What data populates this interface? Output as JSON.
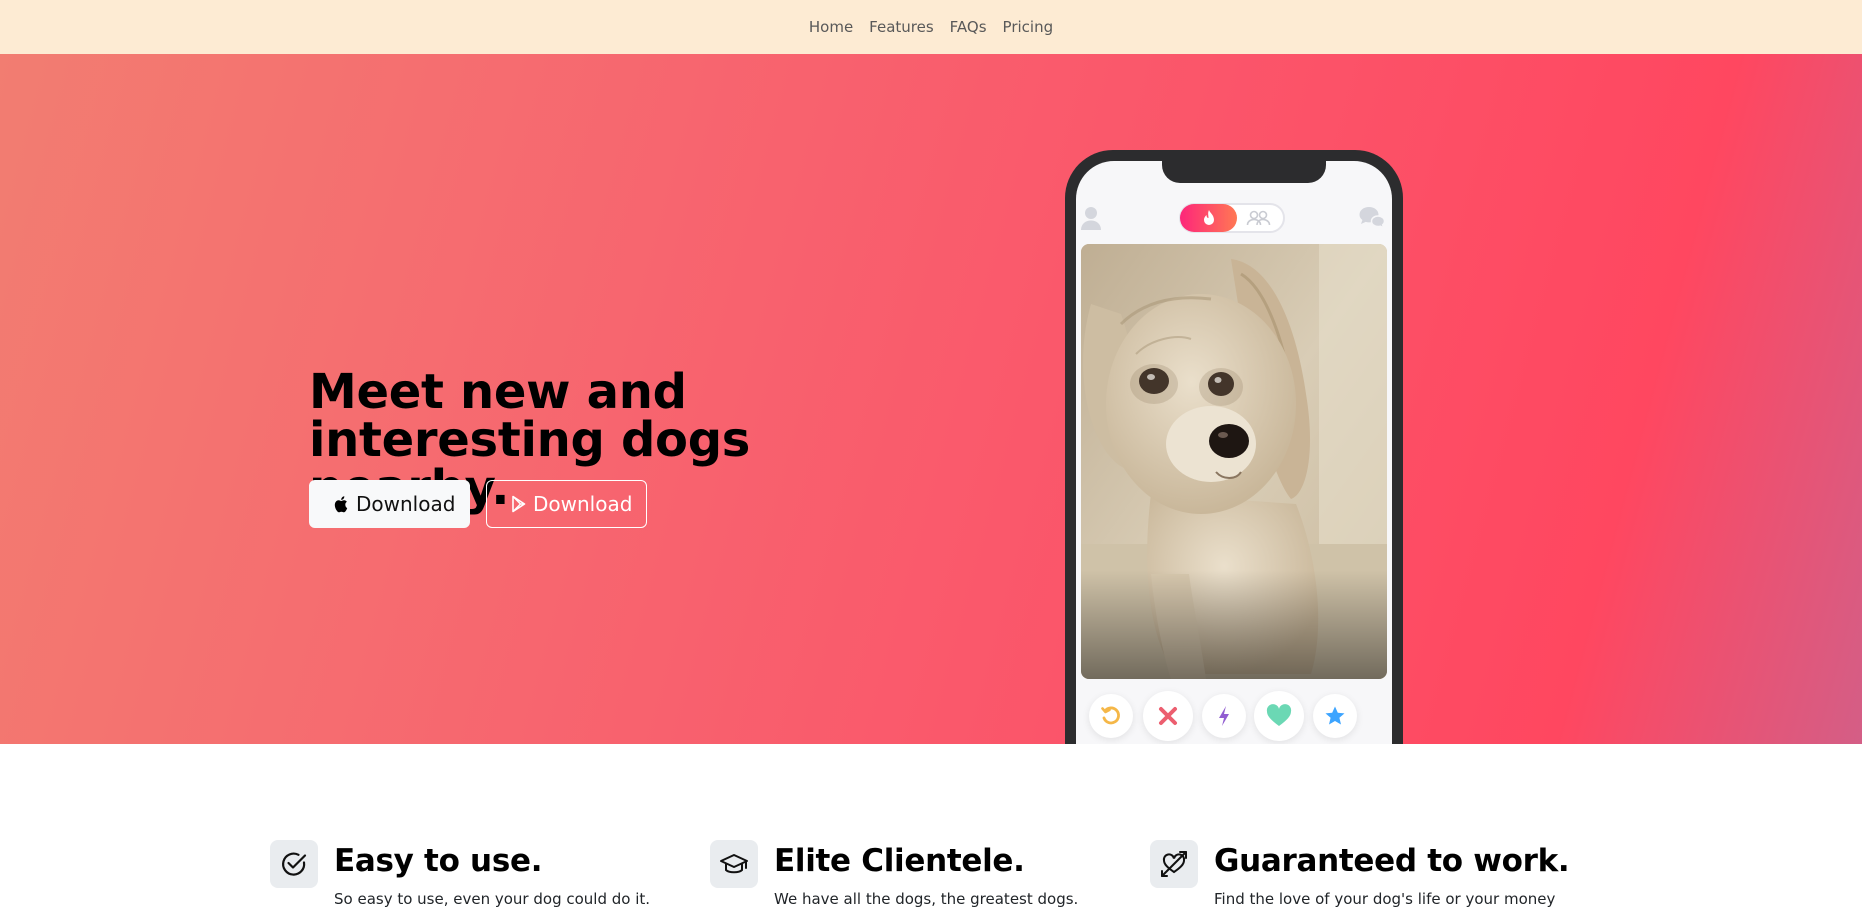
{
  "nav": {
    "items": [
      {
        "label": "Home"
      },
      {
        "label": "Features"
      },
      {
        "label": "FAQs"
      },
      {
        "label": "Pricing"
      }
    ]
  },
  "hero": {
    "title": "Meet new and interesting dogs nearby.",
    "app_store_button": {
      "label": "Download",
      "icon": "apple-icon"
    },
    "play_store_button": {
      "label": "Download",
      "icon": "google-play-icon"
    },
    "colors": {
      "gradient_start": "#f27d71",
      "gradient_end": "#ff4760",
      "accent": "#fd267a"
    }
  },
  "phone": {
    "top_icons": [
      "profile-icon",
      "flame-icon",
      "group-icon",
      "chat-icon"
    ],
    "card_image": "dog-photo",
    "actions": [
      {
        "icon": "rewind-icon",
        "color": "#f5b748"
      },
      {
        "icon": "nope-icon",
        "color": "#ec5e6f"
      },
      {
        "icon": "boost-icon",
        "color": "#915dd1"
      },
      {
        "icon": "like-icon",
        "color": "#6bd8b4"
      },
      {
        "icon": "superlike-icon",
        "color": "#3ca4ff"
      }
    ]
  },
  "features": [
    {
      "icon": "check-circle-icon",
      "title": "Easy to use.",
      "text": "So easy to use, even your dog could do it."
    },
    {
      "icon": "mortarboard-icon",
      "title": "Elite Clientele.",
      "text": "We have all the dogs, the greatest dogs."
    },
    {
      "icon": "heart-arrow-icon",
      "title": "Guaranteed to work.",
      "text": "Find the love of your dog's life or your money"
    }
  ]
}
